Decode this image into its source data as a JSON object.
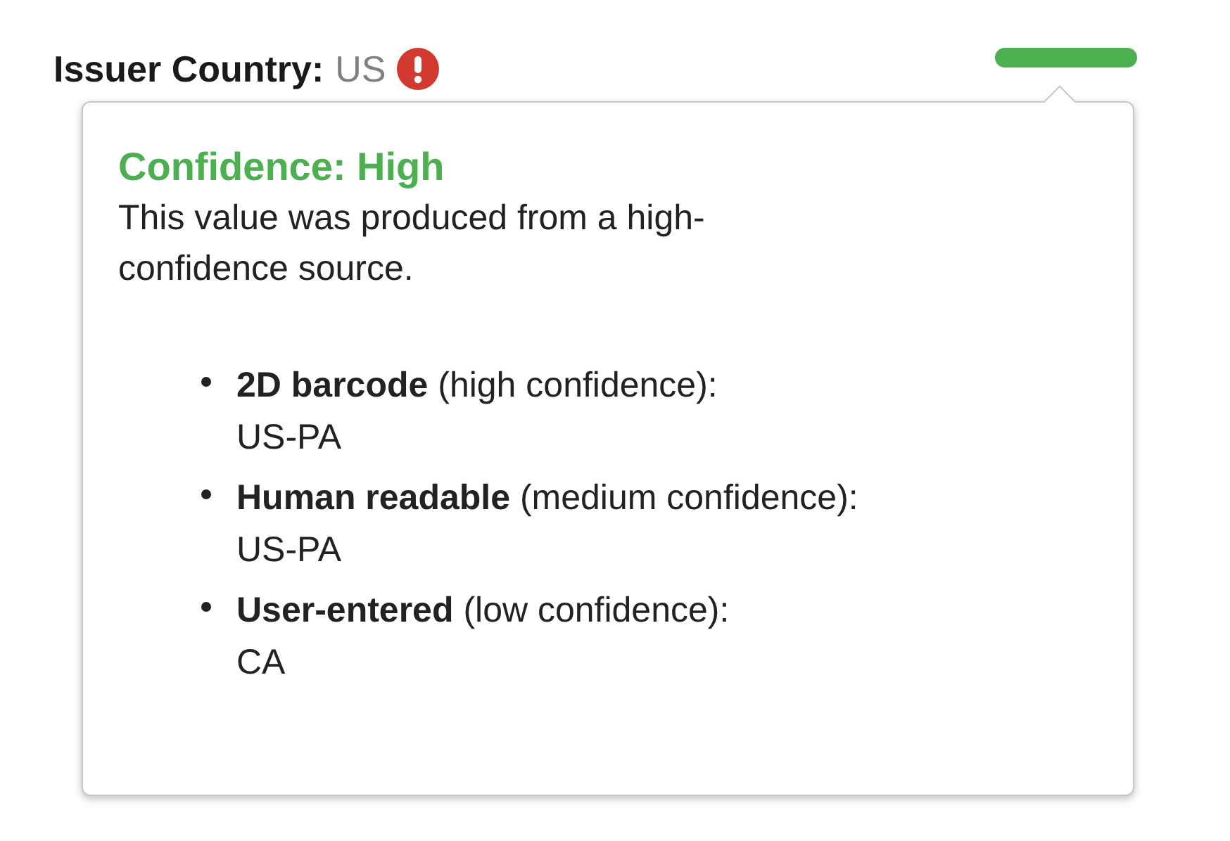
{
  "field": {
    "label": "Issuer Country:",
    "value": "US",
    "warning": true
  },
  "popover": {
    "title": "Confidence: High",
    "description": "This value was produced from a high-confidence source.",
    "sources": [
      {
        "name": "2D barcode",
        "confidence": "(high confidence):",
        "value": "US-PA"
      },
      {
        "name": "Human readable",
        "confidence": "(medium confidence):",
        "value": "US-PA"
      },
      {
        "name": "User-entered",
        "confidence": "(low confidence):",
        "value": "CA"
      }
    ]
  }
}
